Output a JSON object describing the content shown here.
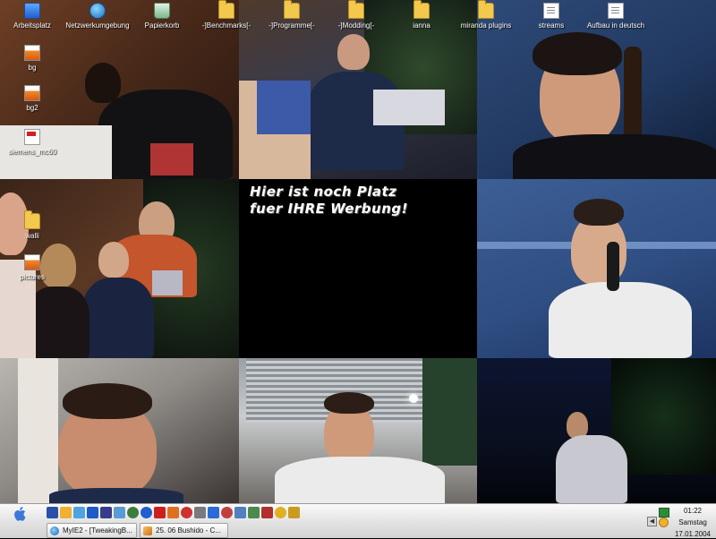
{
  "desktop": {
    "icons": [
      {
        "label": "Arbeitsplatz",
        "icon": "computer-icon"
      },
      {
        "label": "Netzwerkumgebung",
        "icon": "network-icon"
      },
      {
        "label": "Papierkorb",
        "icon": "recycle-bin-icon"
      },
      {
        "label": "-]Benchmarks[-",
        "icon": "folder-icon"
      },
      {
        "label": "-]Programme[-",
        "icon": "folder-icon"
      },
      {
        "label": "-]Modding[-",
        "icon": "folder-icon"
      },
      {
        "label": "ianna",
        "icon": "folder-icon"
      },
      {
        "label": "miranda plugins",
        "icon": "folder-icon"
      },
      {
        "label": "streams",
        "icon": "document-icon"
      },
      {
        "label": "Aufbau in deutsch",
        "icon": "document-icon"
      },
      {
        "label": "bg",
        "icon": "image-icon"
      },
      {
        "label": "bg2",
        "icon": "image-icon"
      },
      {
        "label": "siemens_mc60",
        "icon": "pdf-icon"
      },
      {
        "label": "walli",
        "icon": "folder-icon"
      },
      {
        "label": "pictures",
        "icon": "image-icon"
      }
    ],
    "wallpaper_text": [
      "Hier ist noch Platz",
      "fuer IHRE Werbung!"
    ]
  },
  "taskbar": {
    "quicklaunch": [
      {
        "icon": "app-icon",
        "color": "#2b4fa8"
      },
      {
        "icon": "app-icon",
        "color": "#f0b030"
      },
      {
        "icon": "app-icon",
        "color": "#4fa3e0"
      },
      {
        "icon": "app-icon",
        "color": "#1e5ac8"
      },
      {
        "icon": "app-icon",
        "color": "#3a3a8a"
      },
      {
        "icon": "app-icon",
        "color": "#5b9bd5"
      },
      {
        "icon": "app-icon",
        "color": "#3c7d3c"
      },
      {
        "icon": "app-icon",
        "color": "#1f5fd0"
      },
      {
        "icon": "app-icon",
        "color": "#cc2020"
      },
      {
        "icon": "app-icon",
        "color": "#e07020"
      },
      {
        "icon": "app-icon",
        "color": "#d03030"
      },
      {
        "icon": "app-icon",
        "color": "#7a7a7a"
      },
      {
        "icon": "app-icon",
        "color": "#2a6bd8"
      },
      {
        "icon": "app-icon",
        "color": "#c04040"
      },
      {
        "icon": "app-icon",
        "color": "#5080c0"
      },
      {
        "icon": "app-icon",
        "color": "#4a8a4a"
      },
      {
        "icon": "app-icon",
        "color": "#b03030"
      },
      {
        "icon": "app-icon",
        "color": "#e0b020"
      },
      {
        "icon": "app-icon",
        "color": "#cc9a20"
      }
    ],
    "tasks": [
      {
        "label": "MyIE2 - [TweakingB...",
        "icon": "browser-icon"
      },
      {
        "label": "25. 06 Bushido - C...",
        "icon": "media-player-icon"
      }
    ],
    "clock": {
      "time": "01:22",
      "day": "Samstag",
      "date": "17.01.2004"
    }
  }
}
